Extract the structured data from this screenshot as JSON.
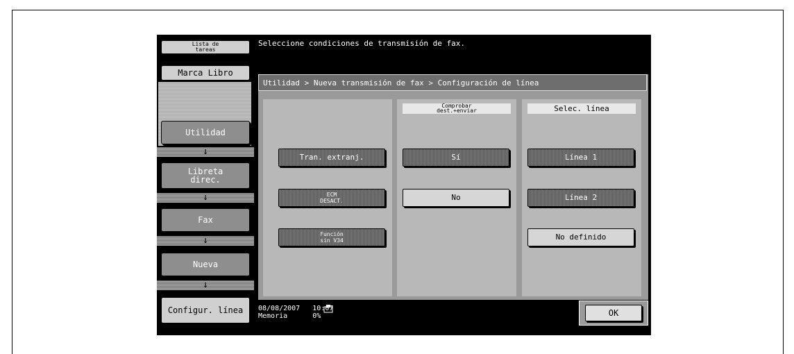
{
  "sidebar": {
    "job_list": "Lista de\ntareas",
    "bookmark": "Marca Libro",
    "utility": "Utilidad",
    "address_book": "Libreta\ndirec.",
    "fax": "Fax",
    "new": "Nueva",
    "line_config": "Configur. línea",
    "arrow": "↓"
  },
  "message": "Seleccione condiciones de transmisión de fax.",
  "breadcrumb": "Utilidad > Nueva transmisión de fax > Configuración de línea",
  "columns": {
    "col2_header": "Comprobar\ndest.+enviar",
    "col3_header": "Selec. línea"
  },
  "options": {
    "overseas": "Tran. extranj.",
    "ecm_off": "ECM\nDESACT.",
    "v34_off": "Función\nsin V34",
    "yes": "Sí",
    "no": "No",
    "line1": "Línea 1",
    "line2": "Línea 2",
    "undefined": "No definido"
  },
  "status": {
    "date": "08/08/2007",
    "time": "10:07",
    "memory_label": "Memoria",
    "memory_value": "0%"
  },
  "ok_label": "OK"
}
